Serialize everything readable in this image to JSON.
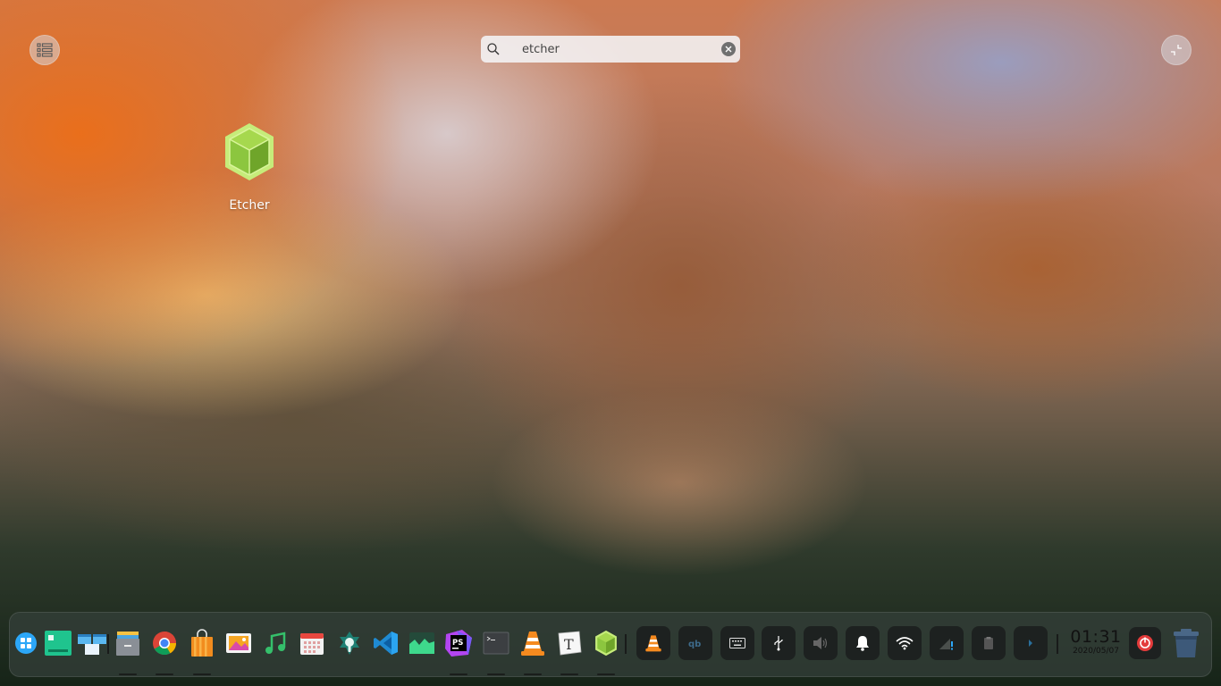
{
  "launcher": {
    "mode_toggle_icon": "list-view-icon",
    "fullscreen_toggle_icon": "exit-fullscreen-icon"
  },
  "search": {
    "value": "etcher",
    "search_icon": "search-icon",
    "clear_icon": "clear-icon"
  },
  "results": [
    {
      "label": "Etcher",
      "icon": "etcher-cube-icon"
    }
  ],
  "dock": {
    "apps": [
      {
        "name": "launcher",
        "icon": "launcher-icon"
      },
      {
        "name": "deepin-manual",
        "icon": "green-window-icon"
      },
      {
        "name": "multitasking-view",
        "icon": "multitasking-icon"
      },
      {
        "name": "file-manager",
        "icon": "file-manager-icon"
      },
      {
        "name": "chrome",
        "icon": "chrome-icon"
      },
      {
        "name": "app-store",
        "icon": "shopping-bag-icon"
      },
      {
        "name": "image-viewer",
        "icon": "photos-icon"
      },
      {
        "name": "music",
        "icon": "music-note-icon"
      },
      {
        "name": "calendar",
        "icon": "calendar-icon"
      },
      {
        "name": "control-center",
        "icon": "control-center-icon"
      },
      {
        "name": "vscode",
        "icon": "vscode-icon"
      },
      {
        "name": "system-monitor",
        "icon": "system-monitor-icon"
      },
      {
        "name": "phpstorm",
        "icon": "phpstorm-icon"
      },
      {
        "name": "terminal",
        "icon": "terminal-icon"
      },
      {
        "name": "vlc",
        "icon": "vlc-cone-icon"
      },
      {
        "name": "typora",
        "icon": "typora-icon"
      },
      {
        "name": "etcher",
        "icon": "etcher-cube-icon"
      }
    ],
    "phpstorm_label": "PS",
    "typora_label": "T",
    "qbittorrent_label": "qb",
    "tray": [
      {
        "name": "vlc-tray",
        "icon": "vlc-cone-icon"
      },
      {
        "name": "qbittorrent-tray",
        "icon": "qbittorrent-icon"
      },
      {
        "name": "keyboard-tray",
        "icon": "keyboard-icon"
      },
      {
        "name": "usb-tray",
        "icon": "usb-icon"
      },
      {
        "name": "volume-tray",
        "icon": "volume-icon"
      },
      {
        "name": "notification-tray",
        "icon": "bell-icon"
      },
      {
        "name": "wifi-tray",
        "icon": "wifi-icon"
      },
      {
        "name": "bluetooth-tray",
        "icon": "network-warning-icon"
      },
      {
        "name": "clipboard-tray",
        "icon": "clipboard-icon"
      },
      {
        "name": "expand-tray",
        "icon": "chevron-right-icon"
      }
    ],
    "clock": {
      "time": "01:31",
      "date": "2020/05/07"
    },
    "power_icon": "power-icon",
    "trash_icon": "trash-icon"
  },
  "colors": {
    "dock_bg": "#34403a",
    "etcher_green": "#a5d63f",
    "accent_blue": "#2ca7f8"
  }
}
